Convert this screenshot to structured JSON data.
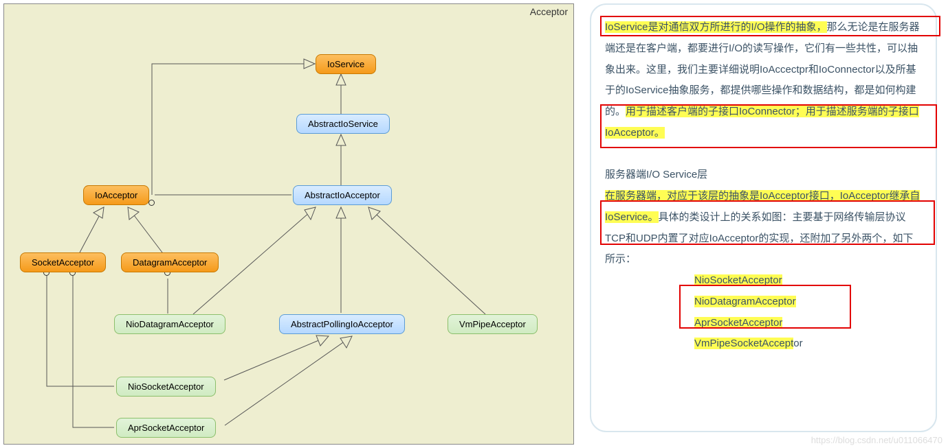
{
  "diagram": {
    "title": "Acceptor",
    "nodes": {
      "ioservice": "IoService",
      "abstract_ioservice": "AbstractIoService",
      "ioacceptor": "IoAcceptor",
      "abstract_ioacceptor": "AbstractIoAcceptor",
      "socket_acceptor": "SocketAcceptor",
      "datagram_acceptor": "DatagramAcceptor",
      "nio_datagram_acceptor": "NioDatagramAcceptor",
      "abstract_polling_ioacceptor": "AbstractPollingIoAcceptor",
      "vmpipe_acceptor": "VmPipeAcceptor",
      "nio_socket_acceptor": "NioSocketAcceptor",
      "apr_socket_acceptor": "AprSocketAcceptor"
    }
  },
  "text": {
    "p1_hl": "IoService是对通信双方所进行的I/O操作的抽象，",
    "p1_rest": "那么无论是在服务器端还是在客户端，都要进行I/O的读写操作，它们有一些共性，可以抽象出来。这里，我们主要详细说明IoAccectpr和IoConnector以及所基于的IoService抽象服务，都提供哪些操作和数据结构，都是如何构建的。",
    "p1_hl2": "用于描述客户端的子接口IoConnector；用于描述服务端的子接口IoAcceptor。",
    "p2_title": "服务器端I/O Service层",
    "p2_hl": "在服务器端，对应于该层的抽象是IoAcceptor接口，IoAcceptor继承自IoService。",
    "p2_rest": "具体的类设计上的关系如图：主要基于网络传输层协议TCP和UDP内置了对应IoAcceptor的实现，还附加了另外两个，如下所示：",
    "impl1": "NioSocketAcceptor",
    "impl2": "NioDatagramAcceptor",
    "impl3": "AprSocketAcceptor",
    "impl4": "VmPipeSocketAccept",
    "impl4_tail": "or"
  },
  "watermark": "https://blog.csdn.net/u011066470"
}
